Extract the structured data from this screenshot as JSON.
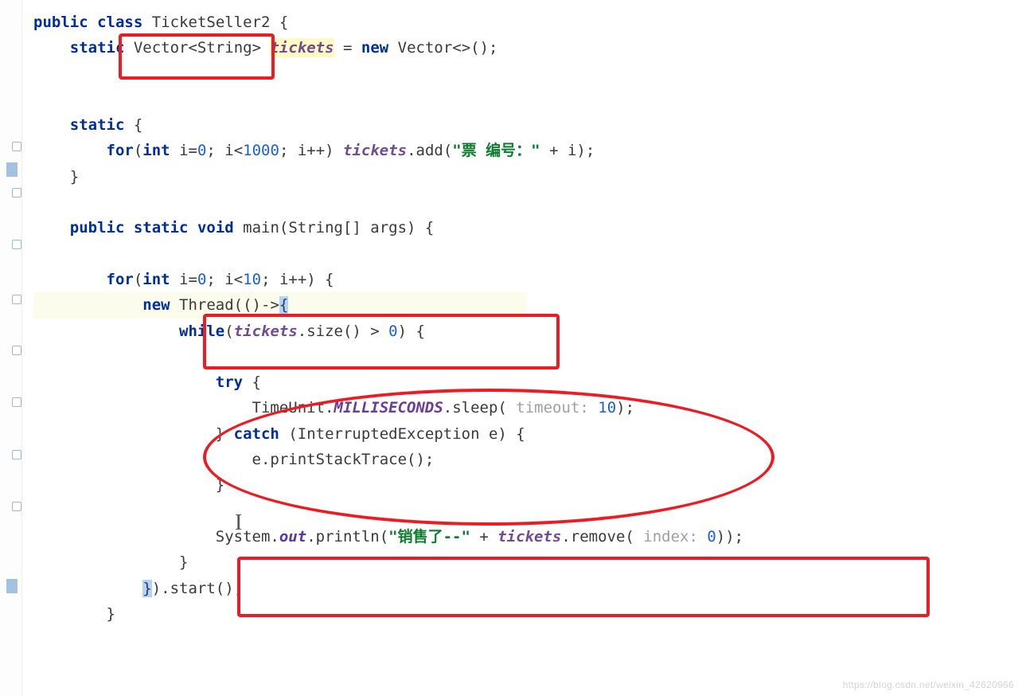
{
  "code": {
    "l1_kw1": "public",
    "l1_kw2": "class",
    "l1_name": "TicketSeller2",
    "l1_brace": "{",
    "l2_kw1": "static",
    "l2_type": "Vector<String>",
    "l2_var": "tickets",
    "l2_eq": " = ",
    "l2_kw2": "new",
    "l2_rest": " Vector<>();",
    "l3_kw": "static",
    "l3_brace": " {",
    "l4_kw1": "for",
    "l4_p1": "(",
    "l4_kw2": "int",
    "l4_rest1": " i=",
    "l4_n0": "0",
    "l4_sc1": "; i<",
    "l4_n1000": "1000",
    "l4_sc2": "; i++) ",
    "l4_var": "tickets",
    "l4_call": ".add(",
    "l4_str": "\"票 编号：\"",
    "l4_rest2": " + i);",
    "l5_brace": "}",
    "l6_kw1": "public",
    "l6_kw2": "static",
    "l6_kw3": "void",
    "l6_sig": " main(String[] args) {",
    "l7_kw1": "for",
    "l7_p1": "(",
    "l7_kw2": "int",
    "l7_rest1": " i=",
    "l7_n0": "0",
    "l7_sc1": "; i<",
    "l7_n10": "10",
    "l7_sc2": "; i++) {",
    "l8_kw": "new",
    "l8_rest1": " Thread(()->",
    "l8_brace": "{",
    "l9_kw": "while",
    "l9_p1": "(",
    "l9_var": "tickets",
    "l9_rest": ".size() > ",
    "l9_n0": "0",
    "l9_rest2": ") {",
    "l10_kw": "try",
    "l10_brace": " {",
    "l11_pre": "TimeUnit.",
    "l11_const": "MILLISECONDS",
    "l11_call": ".sleep(",
    "l11_hint": " timeout: ",
    "l11_n": "10",
    "l11_end": ");",
    "l12_brace": "} ",
    "l12_kw": "catch",
    "l12_rest": " (InterruptedException e) {",
    "l13": "e.printStackTrace();",
    "l14_brace": "}",
    "l15_pre": "System.",
    "l15_out": "out",
    "l15_call": ".println(",
    "l15_str": "\"销售了--\"",
    "l15_plus": " + ",
    "l15_var": "tickets",
    "l15_rem": ".remove(",
    "l15_hint": " index: ",
    "l15_n": "0",
    "l15_end": "));",
    "l16_brace": "}",
    "l17": "}).start();",
    "l18_brace": "}"
  },
  "watermark": "https://blog.csdn.net/weixin_42620966",
  "caret": "I",
  "annotations": {
    "box1": "vector-type-highlight",
    "box2": "while-condition-highlight",
    "box3": "println-remove-highlight",
    "ellipse": "try-catch-sleep-highlight"
  }
}
